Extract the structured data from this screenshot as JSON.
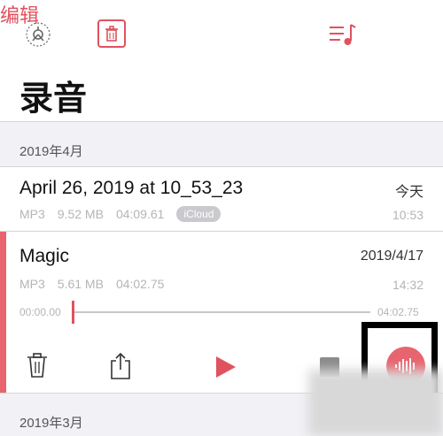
{
  "header": {
    "edit_label": "编辑",
    "title": "录音"
  },
  "sections": [
    {
      "label": "2019年4月"
    },
    {
      "label": "2019年3月"
    }
  ],
  "recordings": [
    {
      "title": "April 26, 2019 at 10_53_23",
      "format": "MP3",
      "size": "9.52 MB",
      "duration": "04:09.61",
      "badge": "iCloud",
      "date": "今天",
      "time": "10:53"
    },
    {
      "title": "Magic",
      "format": "MP3",
      "size": "5.61 MB",
      "duration": "04:02.75",
      "date": "2019/4/17",
      "time": "14:32",
      "scrubber": {
        "current": "00:00.00",
        "total": "04:02.75",
        "progress": 0.0
      }
    }
  ],
  "colors": {
    "accent": "#e0525e",
    "record": "#e8646e",
    "section_bg": "#f2f2f6"
  },
  "icons": [
    "settings-icon",
    "trash-icon",
    "playlist-icon",
    "share-icon",
    "play-icon",
    "stop-icon",
    "record-icon",
    "waveform-icon"
  ]
}
